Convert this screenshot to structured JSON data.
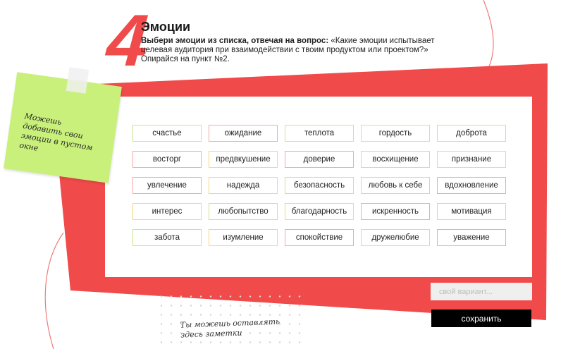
{
  "step": {
    "number": "4",
    "title": "Эмоции"
  },
  "description": {
    "bold": "Выбери эмоции из списка, отвечая на вопрос:",
    "text": " «Какие эмоции испытывает целевая аудитория при взаимодействии с твоим продуктом или проектом?»",
    "hint": "Опирайся на пункт №2."
  },
  "sticky_note": {
    "text": "Можешь добавить свои эмоции в пустом окне"
  },
  "notes_area": {
    "text": "Ты можешь оставлять здесь заметки"
  },
  "emotions": [
    [
      "счастье",
      "ожидание",
      "теплота",
      "гордость",
      "доброта"
    ],
    [
      "восторг",
      "предвкушение",
      "доверие",
      "восхищение",
      "признание"
    ],
    [
      "увлечение",
      "надежда",
      "безопасность",
      "любовь к себе",
      "вдохновление"
    ],
    [
      "интерес",
      "любопытство",
      "благодарность",
      "искренность",
      "мотивация"
    ],
    [
      "забота",
      "изумление",
      "спокойствие",
      "дружелюбие",
      "уважение"
    ]
  ],
  "custom_input": {
    "placeholder": "свой вариант...",
    "value": ""
  },
  "save_button": {
    "label": "сохранить"
  },
  "colors": {
    "accent_red": "#f04a4a",
    "chip_green": "#c9e68a",
    "chip_yellow": "#f5d77a",
    "chip_pink": "#f5a8a8",
    "sticky_green": "#c8f07a"
  }
}
